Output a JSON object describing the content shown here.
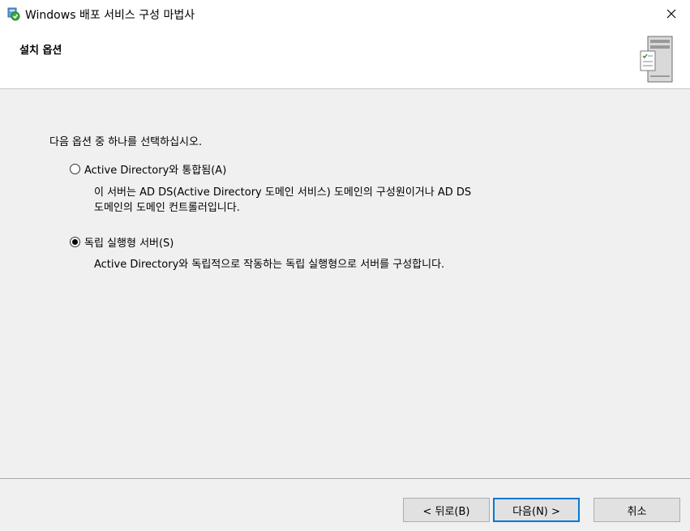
{
  "window": {
    "title": "Windows 배포 서비스 구성 마법사",
    "icon": "wds-setup-icon",
    "close_icon": "close-icon"
  },
  "header": {
    "title": "설치 옵션",
    "image": "server-checklist-icon"
  },
  "main": {
    "instruction": "다음 옵션 중 하나를 선택하십시오.",
    "options": [
      {
        "label": "Active Directory와 통합됨(A)",
        "selected": false,
        "description": [
          "이 서버는 AD DS(Active Directory 도메인 서비스) 도메인의 구성원이거나 AD DS",
          "도메인의 도메인 컨트롤러입니다."
        ]
      },
      {
        "label": "독립 실행형 서버(S)",
        "selected": true,
        "description": [
          "Active Directory와 독립적으로 작동하는 독립 실행형으로 서버를 구성합니다."
        ]
      }
    ]
  },
  "footer": {
    "back_label": "< 뒤로(B)",
    "next_label": "다음(N) >",
    "cancel_label": "취소"
  },
  "colors": {
    "dialog_bg": "#f0f0f0",
    "header_bg": "#ffffff",
    "default_button_border": "#0078d7"
  }
}
